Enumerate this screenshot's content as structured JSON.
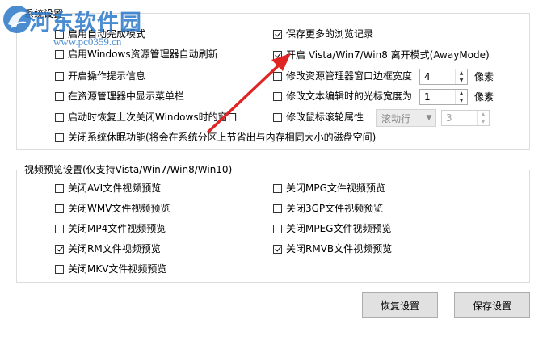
{
  "system_group": {
    "title": "系统设置",
    "left": [
      {
        "label": "启用自动完成模式",
        "checked": false
      },
      {
        "label": "启用Windows资源管理器自动刷新",
        "checked": false
      },
      {
        "label": "开启操作提示信息",
        "checked": false
      },
      {
        "label": "在资源管理器中显示菜单栏",
        "checked": false
      },
      {
        "label": "启动时恢复上次关闭Windows时的窗口",
        "checked": false
      }
    ],
    "right": [
      {
        "label": "保存更多的浏览记录",
        "checked": true
      },
      {
        "label": "开启 Vista/Win7/Win8 离开模式(AwayMode)",
        "checked": true
      },
      {
        "label": "修改资源管理器窗口边框宽度",
        "checked": false
      },
      {
        "label": "修改文本编辑时的光标宽度为",
        "checked": false
      },
      {
        "label": "修改鼠标滚轮属性",
        "checked": false
      }
    ],
    "full": {
      "label": "关闭系统休眠功能(将会在系统分区上节省出与内存相同大小的磁盘空间)",
      "checked": false
    },
    "border_width": {
      "value": "4",
      "unit": "像素"
    },
    "cursor_width": {
      "value": "1",
      "unit": "像素"
    },
    "wheel_mode": {
      "value": "滚动行"
    },
    "wheel_lines": {
      "value": "3"
    }
  },
  "video_group": {
    "title": "视频预览设置(仅支持Vista/Win7/Win8/Win10)",
    "left": [
      {
        "label": "关闭AVI文件视频预览",
        "checked": false
      },
      {
        "label": "关闭WMV文件视频预览",
        "checked": false
      },
      {
        "label": "关闭MP4文件视频预览",
        "checked": false
      },
      {
        "label": "关闭RM文件视频预览",
        "checked": true
      },
      {
        "label": "关闭MKV文件视频预览",
        "checked": false
      }
    ],
    "right": [
      {
        "label": "关闭MPG文件视频预览",
        "checked": false
      },
      {
        "label": "关闭3GP文件视频预览",
        "checked": false
      },
      {
        "label": "关闭MPEG文件视频预览",
        "checked": false
      },
      {
        "label": "关闭RMVB文件视频预览",
        "checked": true
      }
    ]
  },
  "buttons": {
    "restore": "恢复设置",
    "save": "保存设置"
  },
  "watermark": {
    "text": "河东软件园",
    "url": "www.pc0359.cn"
  },
  "colors": {
    "watermark": "#2b78c9",
    "annotation_arrow": "#e02424"
  }
}
